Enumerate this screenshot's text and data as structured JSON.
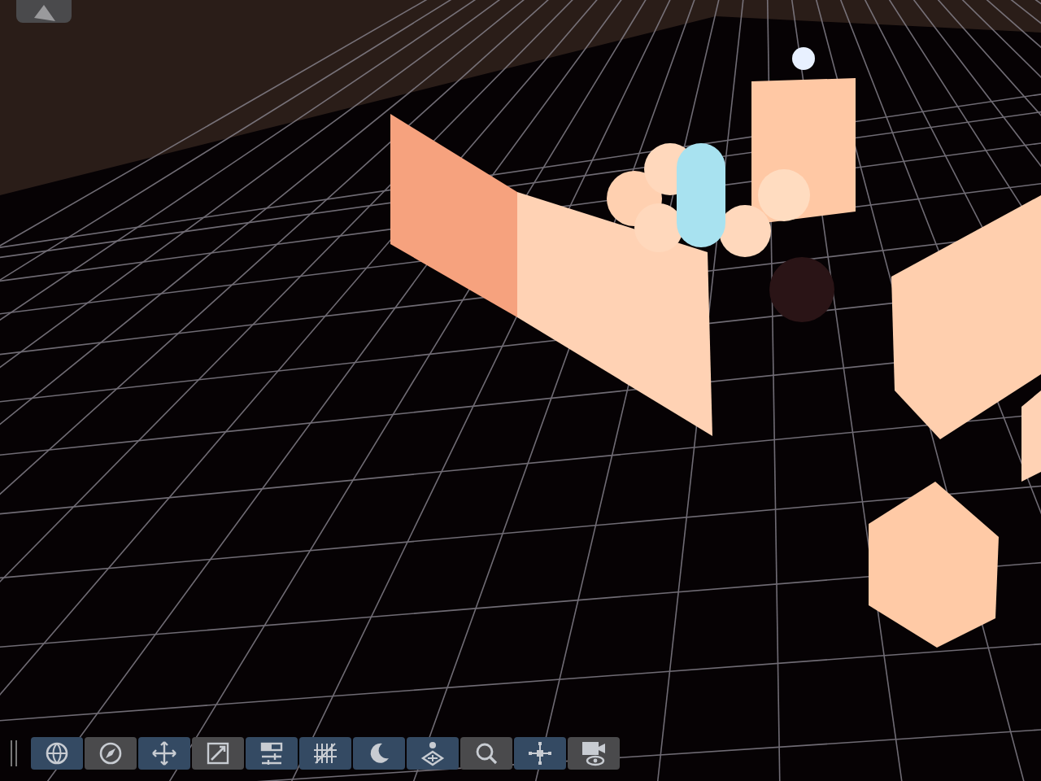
{
  "toolbar": {
    "buttons": [
      {
        "kind": "globe",
        "selected": true
      },
      {
        "kind": "compass",
        "selected": false
      },
      {
        "kind": "move",
        "selected": true
      },
      {
        "kind": "scale",
        "selected": false
      },
      {
        "kind": "sliders",
        "selected": true
      },
      {
        "kind": "hatch",
        "selected": true
      },
      {
        "kind": "crescent",
        "selected": true
      },
      {
        "kind": "layers",
        "selected": true
      },
      {
        "kind": "search",
        "selected": false
      },
      {
        "kind": "nodes",
        "selected": true
      },
      {
        "kind": "camera",
        "selected": false
      }
    ]
  }
}
